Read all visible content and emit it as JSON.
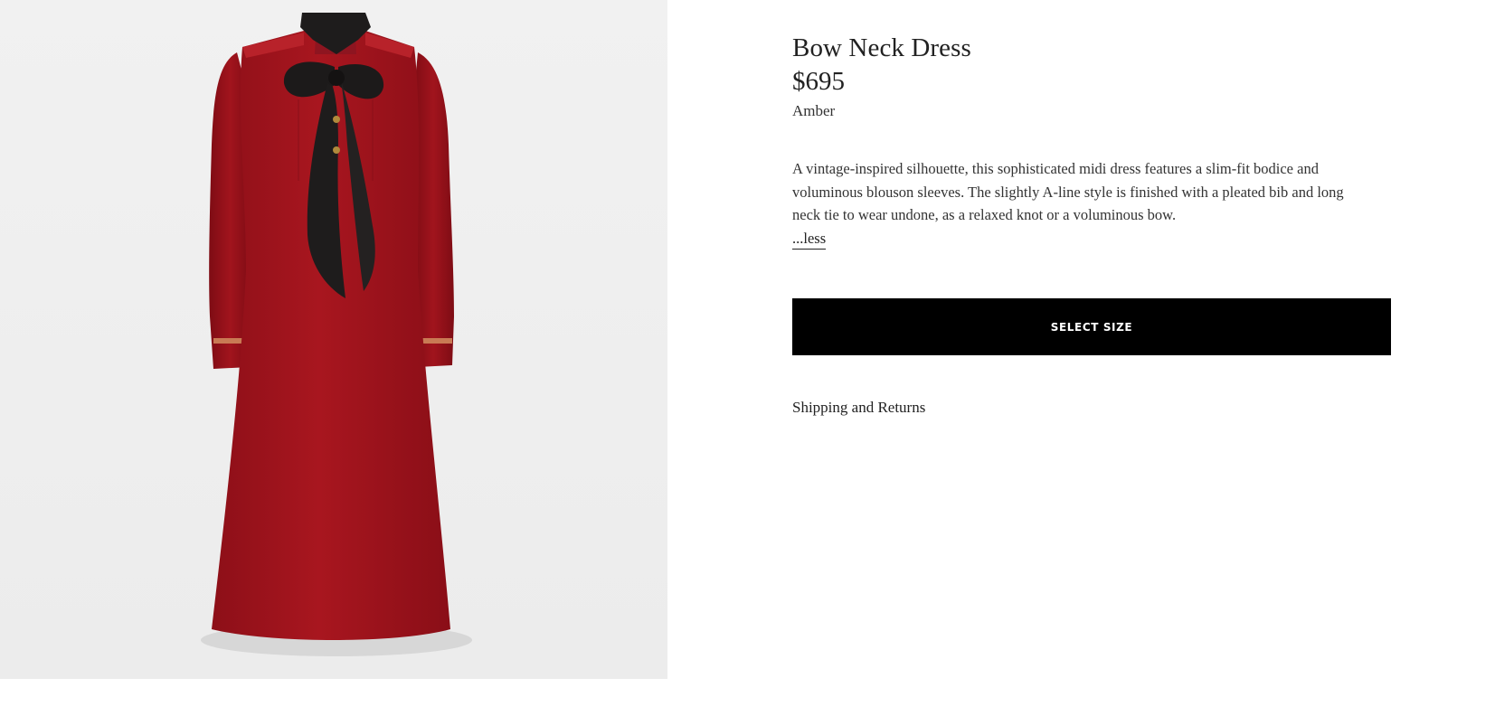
{
  "product": {
    "title": "Bow Neck Dress",
    "price": "$695",
    "color": "Amber",
    "description": "A vintage-inspired silhouette, this sophisticated midi dress features a slim-fit bodice and voluminous blouson sleeves. The slightly A-line style is finished with a pleated bib and long neck tie to wear undone, as a relaxed knot or a voluminous bow.",
    "less_label": "...less"
  },
  "actions": {
    "select_size_label": "SELECT SIZE"
  },
  "links": {
    "shipping_label": "Shipping and Returns"
  },
  "image": {
    "subject": "red midi dress with black neck bow",
    "dress_color": "#a3141e",
    "bow_color": "#1c1a1a",
    "background_color": "#eeeeee"
  }
}
